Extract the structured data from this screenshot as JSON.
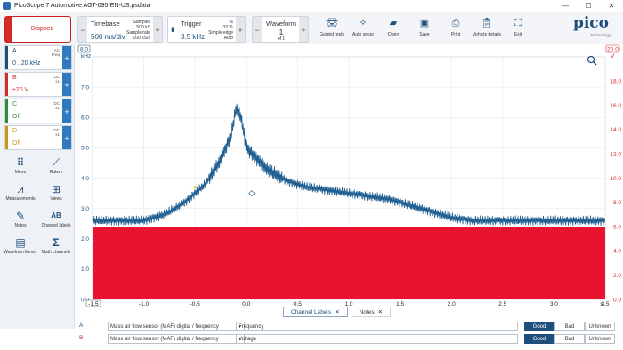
{
  "window": {
    "title": "PicoScope 7 Automotive AGT-095-EN-US.psdata",
    "minimize": "—",
    "maximize": "☐",
    "close": "✕"
  },
  "toolbar": {
    "run_state": "Stopped",
    "timebase": {
      "label": "Timebase",
      "value": "500 ms/div",
      "samples_label": "Samples",
      "samples": "500 kS",
      "rate_label": "Sample rate",
      "rate": "100 kS/s"
    },
    "trigger": {
      "label": "Trigger",
      "value": "3.5 kHz",
      "percent": "%",
      "pre": "32 %",
      "mode1": "Simple edge",
      "mode2": "Auto"
    },
    "waveform": {
      "label": "Waveform",
      "value": "1",
      "of": "of 1"
    },
    "buttons": [
      {
        "label": "Guided tests",
        "icon": "car-icon"
      },
      {
        "label": "Auto setup",
        "icon": "wand-icon"
      },
      {
        "label": "Open",
        "icon": "folder-icon"
      },
      {
        "label": "Save",
        "icon": "save-icon"
      },
      {
        "label": "Print",
        "icon": "printer-icon"
      },
      {
        "label": "Vehicle details",
        "icon": "clipboard-icon"
      },
      {
        "label": "Exit",
        "icon": "fullscreen-icon"
      }
    ],
    "logo": "pico",
    "logo_sub": "Technology"
  },
  "channels": [
    {
      "name": "A",
      "coupling": "AC",
      "probe": "Freq",
      "range": "0 . 20 kHz",
      "color": "#1d4f7d"
    },
    {
      "name": "B",
      "coupling": "DC",
      "probe": "x1",
      "range": "±20 V",
      "color": "#d42a2a"
    },
    {
      "name": "C",
      "coupling": "DC",
      "probe": "x1",
      "range": "Off",
      "color": "#2e8b3a"
    },
    {
      "name": "D",
      "coupling": "DC",
      "probe": "x1",
      "range": "Off",
      "color": "#c89a10"
    }
  ],
  "tools": [
    {
      "label": "Menu",
      "icon": "menu-icon"
    },
    {
      "label": "Rulers",
      "icon": "ruler-icon"
    },
    {
      "label": "Measurements",
      "icon": "measurements-icon"
    },
    {
      "label": "Views",
      "icon": "views-icon"
    },
    {
      "label": "Notes",
      "icon": "notes-icon"
    },
    {
      "label": "Channel labels",
      "icon": "channel-labels-icon"
    },
    {
      "label": "Waveform library",
      "icon": "waveform-library-icon"
    },
    {
      "label": "Math channels",
      "icon": "math-icon"
    }
  ],
  "scope": {
    "left_unit": "kHz",
    "left_top": "8.0",
    "left_ticks": [
      "7.0",
      "6.0",
      "5.0",
      "4.0",
      "3.0",
      "2.0",
      "1.0",
      "0.0"
    ],
    "right_unit": "V",
    "right_top": "20.0",
    "right_ticks": [
      "18.0",
      "16.0",
      "14.0",
      "12.0",
      "10.0",
      "8.0",
      "6.0",
      "4.0",
      "2.0",
      "0.0"
    ],
    "x_ticks": [
      "-1.5",
      "-1.0",
      "-0.5",
      "0.0",
      "0.5",
      "1.0",
      "1.5",
      "2.0",
      "2.5",
      "3.0",
      "3.5"
    ],
    "x_label": "s",
    "zoom_icon": "zoom-icon"
  },
  "bottom": {
    "tabs": [
      {
        "label": "Channel Labels",
        "close": "✕"
      },
      {
        "label": "Notes",
        "close": "✕"
      }
    ],
    "rows": [
      {
        "channel": "A",
        "sensor": "Mass air flow sensor (MAF) digital / frequency",
        "text": "Frequency",
        "options": [
          "Good",
          "Bad",
          "Unknown"
        ],
        "selected": "Good"
      },
      {
        "channel": "B",
        "sensor": "Mass air flow sensor (MAF) digital / frequency",
        "text": "Voltage",
        "options": [
          "Good",
          "Bad",
          "Unknown"
        ],
        "selected": "Good"
      }
    ]
  },
  "chart_data": {
    "type": "line",
    "series": [
      {
        "name": "A",
        "axis": "left",
        "x": [
          -1.5,
          -1.2,
          -1.0,
          -0.8,
          -0.6,
          -0.4,
          -0.25,
          -0.15,
          -0.1,
          -0.05,
          0.0,
          0.2,
          0.4,
          0.6,
          0.8,
          1.0,
          1.2,
          1.4,
          1.6,
          1.8,
          2.0,
          2.2,
          2.5,
          3.0,
          3.5
        ],
        "y": [
          2.6,
          2.6,
          2.6,
          2.8,
          3.2,
          3.8,
          4.6,
          5.4,
          6.3,
          6.0,
          5.0,
          4.3,
          3.9,
          3.7,
          3.6,
          3.5,
          3.4,
          3.3,
          3.1,
          2.9,
          2.7,
          2.6,
          2.6,
          2.6,
          2.6
        ]
      },
      {
        "name": "B",
        "axis": "right",
        "x_range": [
          -1.5,
          3.5
        ],
        "low": 0.0,
        "high": 6.0
      }
    ],
    "xlim": [
      -1.5,
      3.5
    ],
    "ylim_left": [
      0,
      8
    ],
    "ylim_right": [
      0,
      20
    ]
  }
}
